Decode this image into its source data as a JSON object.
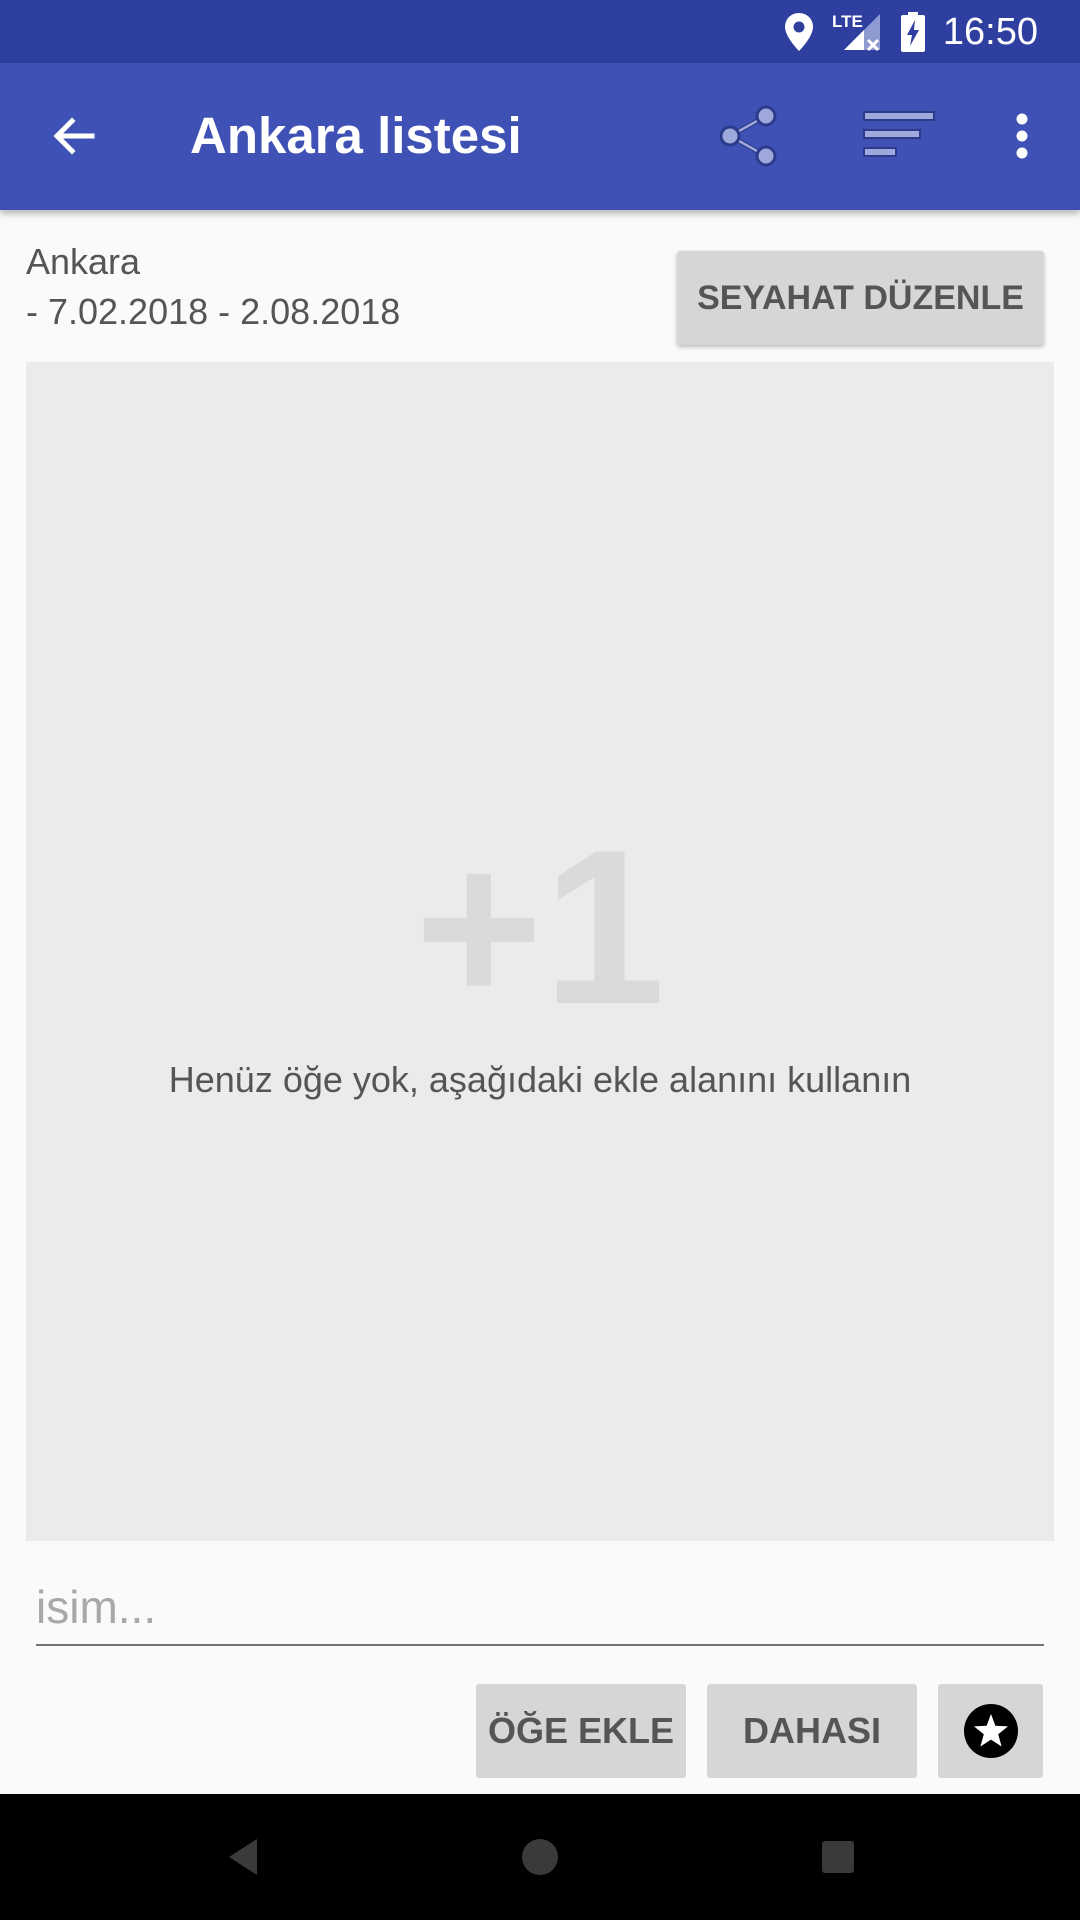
{
  "status_bar": {
    "time": "16:50",
    "network_label": "LTE",
    "icons": [
      "location-icon",
      "signal-icon",
      "battery-icon"
    ]
  },
  "app_bar": {
    "title": "Ankara listesi",
    "icons": [
      "back-arrow-icon",
      "share-icon",
      "sort-icon",
      "more-vert-icon"
    ]
  },
  "trip": {
    "city": "Ankara",
    "dates": "- 7.02.2018 - 2.08.2018",
    "edit_button_label": "SEYAHAT DÜZENLE"
  },
  "empty_state": {
    "big_text": "+1",
    "message": "Henüz öğe yok, aşağıdaki ekle alanını kullanın"
  },
  "add_form": {
    "name_placeholder": "isim...",
    "name_value": "",
    "add_item_label": "ÖĞE EKLE",
    "more_label": "DAHASI",
    "favorite_icon": "star-icon"
  },
  "nav_bar": {
    "icons": [
      "nav-back-icon",
      "nav-home-icon",
      "nav-recents-icon"
    ]
  },
  "colors": {
    "status_bar": "#2f3f9f",
    "app_bar": "#3f51b5",
    "button_bg": "#d6d6d6",
    "panel_bg": "#ebebeb"
  }
}
